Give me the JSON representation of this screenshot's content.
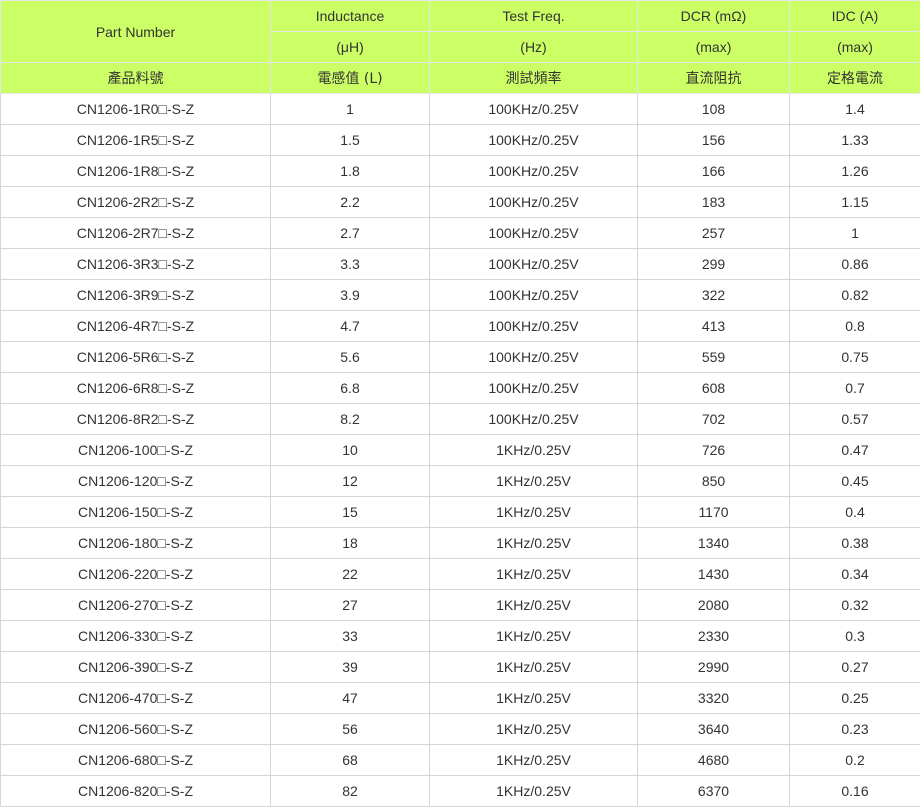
{
  "header": {
    "part_number": "Part Number",
    "inductance": "Inductance",
    "test_freq": "Test Freq.",
    "dcr": "DCR (mΩ)",
    "idc": "IDC (A)",
    "inductance_unit": "(μH)",
    "test_freq_unit": "(Hz)",
    "dcr_unit": "(max)",
    "idc_unit": "(max)",
    "part_number_cn": "產品料號",
    "inductance_cn": "電感值 (L)",
    "test_freq_cn": "測試頻率",
    "dcr_cn": "直流阻抗",
    "idc_cn": "定格電流"
  },
  "rows": [
    {
      "part": "CN1206-1R0□-S-Z",
      "ind": "1",
      "freq": "100KHz/0.25V",
      "dcr": "108",
      "idc": "1.4"
    },
    {
      "part": "CN1206-1R5□-S-Z",
      "ind": "1.5",
      "freq": "100KHz/0.25V",
      "dcr": "156",
      "idc": "1.33"
    },
    {
      "part": "CN1206-1R8□-S-Z",
      "ind": "1.8",
      "freq": "100KHz/0.25V",
      "dcr": "166",
      "idc": "1.26"
    },
    {
      "part": "CN1206-2R2□-S-Z",
      "ind": "2.2",
      "freq": "100KHz/0.25V",
      "dcr": "183",
      "idc": "1.15"
    },
    {
      "part": "CN1206-2R7□-S-Z",
      "ind": "2.7",
      "freq": "100KHz/0.25V",
      "dcr": "257",
      "idc": "1"
    },
    {
      "part": "CN1206-3R3□-S-Z",
      "ind": "3.3",
      "freq": "100KHz/0.25V",
      "dcr": "299",
      "idc": "0.86"
    },
    {
      "part": "CN1206-3R9□-S-Z",
      "ind": "3.9",
      "freq": "100KHz/0.25V",
      "dcr": "322",
      "idc": "0.82"
    },
    {
      "part": "CN1206-4R7□-S-Z",
      "ind": "4.7",
      "freq": "100KHz/0.25V",
      "dcr": "413",
      "idc": "0.8"
    },
    {
      "part": "CN1206-5R6□-S-Z",
      "ind": "5.6",
      "freq": "100KHz/0.25V",
      "dcr": "559",
      "idc": "0.75"
    },
    {
      "part": "CN1206-6R8□-S-Z",
      "ind": "6.8",
      "freq": "100KHz/0.25V",
      "dcr": "608",
      "idc": "0.7"
    },
    {
      "part": "CN1206-8R2□-S-Z",
      "ind": "8.2",
      "freq": "100KHz/0.25V",
      "dcr": "702",
      "idc": "0.57"
    },
    {
      "part": "CN1206-100□-S-Z",
      "ind": "10",
      "freq": "1KHz/0.25V",
      "dcr": "726",
      "idc": "0.47"
    },
    {
      "part": "CN1206-120□-S-Z",
      "ind": "12",
      "freq": "1KHz/0.25V",
      "dcr": "850",
      "idc": "0.45"
    },
    {
      "part": "CN1206-150□-S-Z",
      "ind": "15",
      "freq": "1KHz/0.25V",
      "dcr": "1170",
      "idc": "0.4"
    },
    {
      "part": "CN1206-180□-S-Z",
      "ind": "18",
      "freq": "1KHz/0.25V",
      "dcr": "1340",
      "idc": "0.38"
    },
    {
      "part": "CN1206-220□-S-Z",
      "ind": "22",
      "freq": "1KHz/0.25V",
      "dcr": "1430",
      "idc": "0.34"
    },
    {
      "part": "CN1206-270□-S-Z",
      "ind": "27",
      "freq": "1KHz/0.25V",
      "dcr": "2080",
      "idc": "0.32"
    },
    {
      "part": "CN1206-330□-S-Z",
      "ind": "33",
      "freq": "1KHz/0.25V",
      "dcr": "2330",
      "idc": "0.3"
    },
    {
      "part": "CN1206-390□-S-Z",
      "ind": "39",
      "freq": "1KHz/0.25V",
      "dcr": "2990",
      "idc": "0.27"
    },
    {
      "part": "CN1206-470□-S-Z",
      "ind": "47",
      "freq": "1KHz/0.25V",
      "dcr": "3320",
      "idc": "0.25"
    },
    {
      "part": "CN1206-560□-S-Z",
      "ind": "56",
      "freq": "1KHz/0.25V",
      "dcr": "3640",
      "idc": "0.23"
    },
    {
      "part": "CN1206-680□-S-Z",
      "ind": "68",
      "freq": "1KHz/0.25V",
      "dcr": "4680",
      "idc": "0.2"
    },
    {
      "part": "CN1206-820□-S-Z",
      "ind": "82",
      "freq": "1KHz/0.25V",
      "dcr": "6370",
      "idc": "0.16"
    }
  ]
}
